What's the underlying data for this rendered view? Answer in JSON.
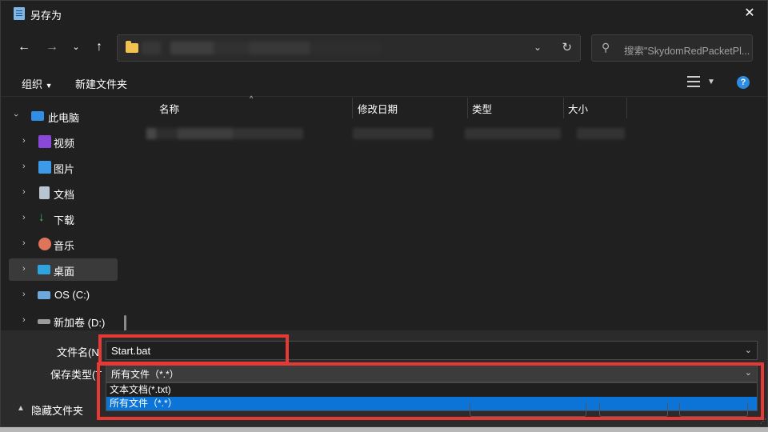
{
  "window": {
    "title": "另存为"
  },
  "address_bar": {},
  "search": {
    "placeholder": "搜索\"SkydomRedPacketPl..."
  },
  "toolbar": {
    "organize_label": "组织",
    "new_folder_label": "新建文件夹"
  },
  "sidebar": {
    "items": [
      {
        "label": "此电脑",
        "icon": "computer-icon"
      },
      {
        "label": "视频",
        "icon": "video-icon"
      },
      {
        "label": "图片",
        "icon": "picture-icon"
      },
      {
        "label": "文档",
        "icon": "document-icon"
      },
      {
        "label": "下载",
        "icon": "download-icon"
      },
      {
        "label": "音乐",
        "icon": "music-icon"
      },
      {
        "label": "桌面",
        "icon": "desktop-icon"
      },
      {
        "label": "OS (C:)",
        "icon": "drive-c-icon"
      },
      {
        "label": "新加卷 (D:)",
        "icon": "drive-d-icon"
      }
    ]
  },
  "columns": {
    "name": "名称",
    "modified": "修改日期",
    "type": "类型",
    "size": "大小"
  },
  "save_form": {
    "filename_label": "文件名(N",
    "filename_value": "Start.bat",
    "type_label": "保存类型(T",
    "type_value": "所有文件（*.*）",
    "type_options": [
      "文本文档(*.txt)",
      "所有文件（*.*）"
    ]
  },
  "footer": {
    "hide_folders_label": "隐藏文件夹"
  },
  "colors": {
    "highlight": "#e53935",
    "selection": "#0b74d6",
    "accent": "#2d8be0"
  }
}
